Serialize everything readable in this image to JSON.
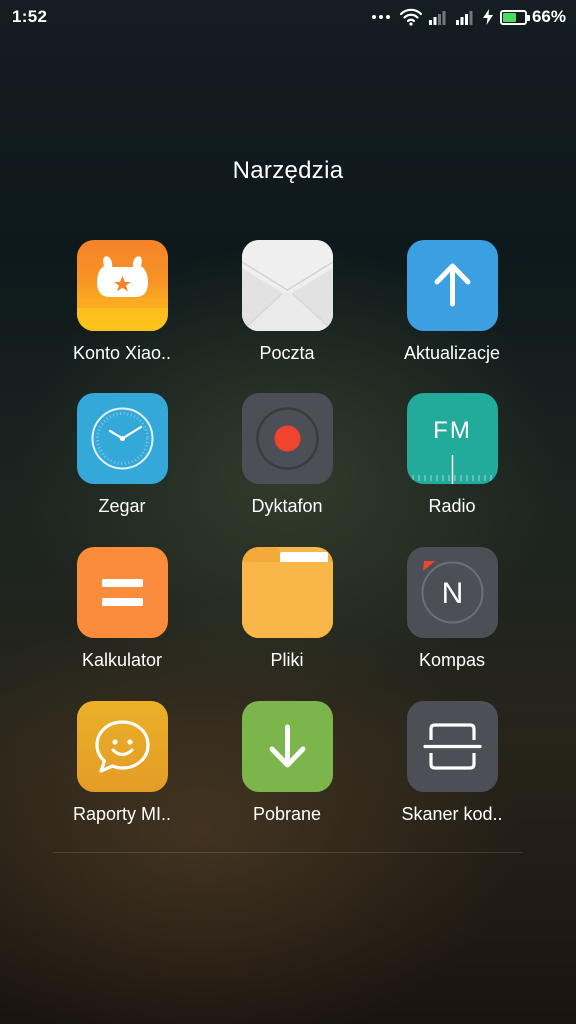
{
  "status_bar": {
    "time": "1:52",
    "battery_percent": "66%",
    "battery_level": 0.66,
    "icons": [
      "more-dots-icon",
      "wifi-icon",
      "signal-icon",
      "signal-icon",
      "charging-icon",
      "battery-icon"
    ]
  },
  "folder": {
    "title": "Narzędzia",
    "apps": [
      {
        "label": "Konto Xiao..",
        "icon": "mi-bunny-icon",
        "color": "#f59a22"
      },
      {
        "label": "Poczta",
        "icon": "envelope-icon",
        "color": "#eeeeee"
      },
      {
        "label": "Aktualizacje",
        "icon": "arrow-up-icon",
        "color": "#3b9fe1"
      },
      {
        "label": "Zegar",
        "icon": "clock-icon",
        "color": "#34a8d9"
      },
      {
        "label": "Dyktafon",
        "icon": "record-icon",
        "color": "#4c4f56"
      },
      {
        "label": "Radio",
        "icon": "fm-radio-icon",
        "color": "#22aa9a"
      },
      {
        "label": "Kalkulator",
        "icon": "calculator-icon",
        "color": "#fb8c3c"
      },
      {
        "label": "Pliki",
        "icon": "folder-icon",
        "color": "#f9b74a"
      },
      {
        "label": "Kompas",
        "icon": "compass-icon",
        "color": "#4c4f56"
      },
      {
        "label": "Raporty MI..",
        "icon": "chat-smile-icon",
        "color": "#ebab26"
      },
      {
        "label": "Pobrane",
        "icon": "download-arrow-icon",
        "color": "#7bb54c"
      },
      {
        "label": "Skaner kod..",
        "icon": "scanner-icon",
        "color": "#4c4f56"
      }
    ]
  }
}
